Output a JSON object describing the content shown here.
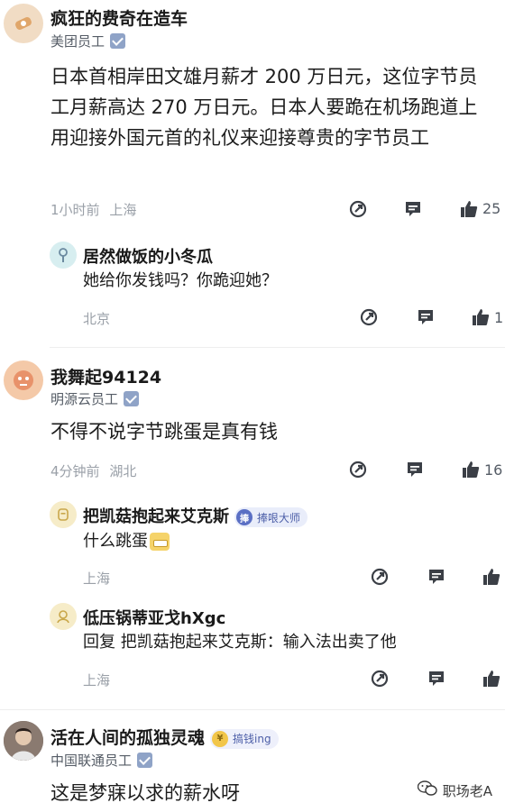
{
  "comments": [
    {
      "name": "疯狂的费奇在造车",
      "org": "美团员工",
      "text": "日本首相岸田文雄月薪才 200 万日元，这位字节员工月薪高达 270 万日元。日本人要跪在机场跑道上用迎接外国元首的礼仪来迎接尊贵的字节员工",
      "time": "1小时前",
      "location": "上海",
      "likes": "25",
      "replies": [
        {
          "name": "居然做饭的小冬瓜",
          "text": "她给你发钱吗？你跪迎她？",
          "location": "北京",
          "likes": "1"
        }
      ]
    },
    {
      "name": "我舞起94124",
      "org": "明源云员工",
      "text": "不得不说字节跳蛋是真有钱",
      "time": "4分钟前",
      "location": "湖北",
      "likes": "16",
      "replies": [
        {
          "name": "把凯菇抱起来艾克斯",
          "badge": "捧哏大师",
          "badge_char": "捧",
          "text": "什么跳蛋",
          "location": "上海"
        },
        {
          "name": "低压锅蒂亚戈hXgc",
          "text": "回复 把凯菇抱起来艾克斯：输入法出卖了他",
          "location": "上海"
        }
      ]
    },
    {
      "name": "活在人间的孤独灵魂",
      "badge": "搞钱ing",
      "org": "中国联通员工",
      "text": "这是梦寐以求的薪水呀"
    }
  ],
  "watermark": "职场老A",
  "colors": {
    "icon": "#3b3f46",
    "verify": "#8fa3c7",
    "badge_bg": "#e9edfa",
    "badge_text": "#4d5fa8"
  },
  "icons": [
    "share-icon",
    "comment-icon",
    "like-icon",
    "verified-icon"
  ]
}
